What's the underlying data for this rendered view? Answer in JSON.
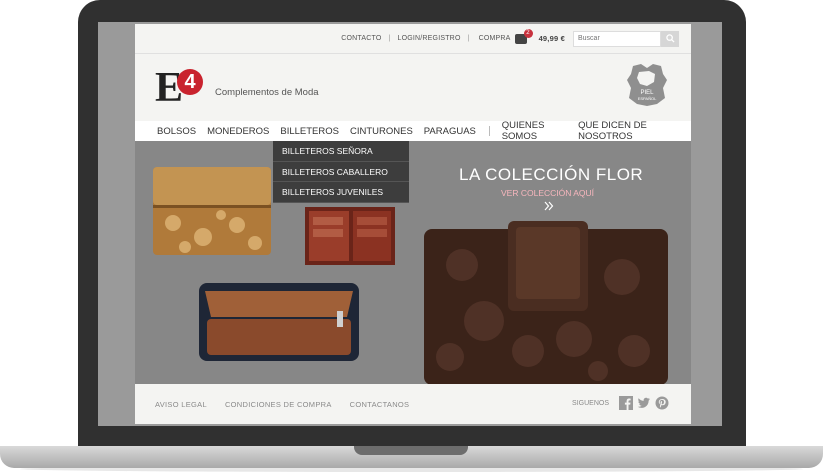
{
  "topbar": {
    "contact": "CONTACTO",
    "login": "LOGIN/REGISTRO",
    "cart_label": "COMPRA",
    "cart_count": "2",
    "price": "49,99 €",
    "search_placeholder": "Buscar"
  },
  "header": {
    "logo_letter": "E",
    "logo_number": "4",
    "tagline": "Complementos de Moda",
    "badge_line1": "PIEL",
    "badge_line2": "ESPAÑOL"
  },
  "nav": {
    "items": [
      {
        "label": "BOLSOS"
      },
      {
        "label": "MONEDEROS"
      },
      {
        "label": "BILLETEROS"
      },
      {
        "label": "CINTURONES"
      },
      {
        "label": "PARAGUAS"
      },
      {
        "label": "QUIENES SOMOS"
      },
      {
        "label": "QUE DICEN DE NOSOTROS"
      }
    ]
  },
  "dropdown": {
    "items": [
      {
        "label": "BILLETEROS SEÑORA"
      },
      {
        "label": "BILLETEROS CABALLERO"
      },
      {
        "label": "BILLETEROS JUVENILES"
      }
    ]
  },
  "hero": {
    "title": "LA COLECCIÓN FLOR",
    "subtitle": "VER COLECCIÓN AQUÍ"
  },
  "footer": {
    "links": [
      "AVISO LEGAL",
      "CONDICIONES DE COMPRA",
      "CONTACTANOS"
    ],
    "social_label": "SIGUENOS"
  },
  "colors": {
    "brand_red": "#c9232e",
    "dropdown_bg": "#3d3d3d",
    "hero_bg": "#878787",
    "accent_pink": "#f7b6bd"
  }
}
